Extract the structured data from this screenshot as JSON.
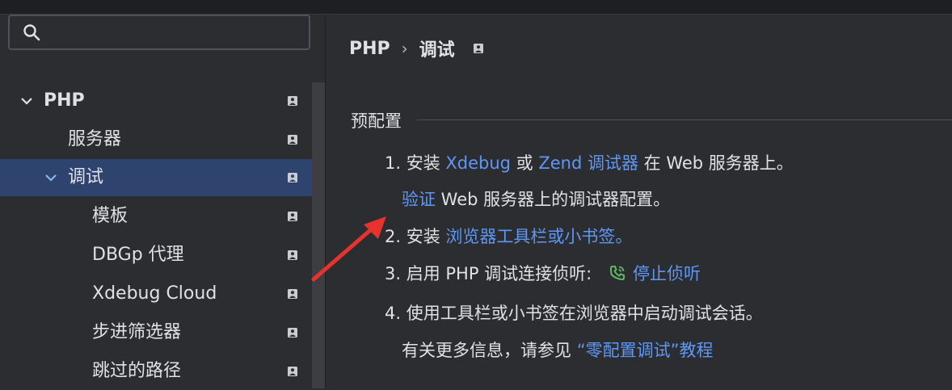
{
  "search": {
    "value": "",
    "placeholder": ""
  },
  "tree": [
    {
      "label": "PHP",
      "chevron": "down"
    },
    {
      "label": "服务器"
    },
    {
      "label": "调试",
      "chevron": "down",
      "selected": true
    },
    {
      "label": "模板"
    },
    {
      "label": "DBGp 代理"
    },
    {
      "label": "Xdebug Cloud"
    },
    {
      "label": "步进筛选器"
    },
    {
      "label": "跳过的路径"
    }
  ],
  "breadcrumb": {
    "parent": "PHP",
    "separator": "›",
    "current": "调试"
  },
  "section": {
    "title": "预配置"
  },
  "steps": {
    "s1_prefix": "1. 安装 ",
    "s1_link1": "Xdebug",
    "s1_mid": " 或 ",
    "s1_link2": "Zend 调试器",
    "s1_suffix": " 在 Web 服务器上。",
    "s1b_link": "验证",
    "s1b_suffix": " Web 服务器上的调试器配置。",
    "s2_prefix": "2. 安装 ",
    "s2_link": "浏览器工具栏或小书签。",
    "s3_prefix": "3. 启用 PHP 调试连接侦听:",
    "s3_link": "停止侦听",
    "s4_text": "4. 使用工具栏或小书签在浏览器中启动调试会话。",
    "s4b_prefix": "有关更多信息，请参见 ",
    "s4b_link": "“零配置调试”",
    "s4b_suffix": "教程"
  },
  "colors": {
    "link": "#5f97f5",
    "selection": "#2e436e",
    "phone_icon": "#5fb865",
    "arrow": "#e8322e"
  }
}
